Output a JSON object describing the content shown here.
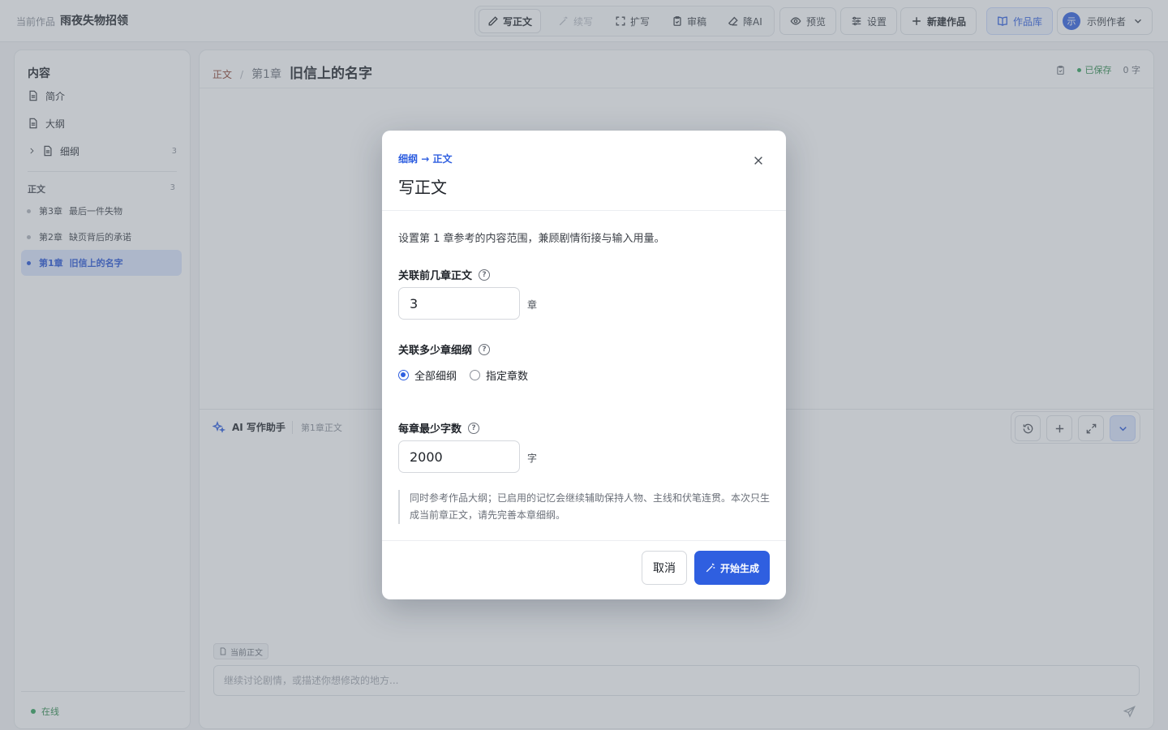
{
  "header": {
    "project_label": "当前作品",
    "project_name": "雨夜失物招领",
    "tools": [
      {
        "label": "写正文",
        "icon": "pencil-icon",
        "state": "active"
      },
      {
        "label": "续写",
        "icon": "magic-wand-icon",
        "state": "disabled"
      },
      {
        "label": "扩写",
        "icon": "expand-icon",
        "state": "normal"
      },
      {
        "label": "审稿",
        "icon": "clipboard-check-icon",
        "state": "normal"
      },
      {
        "label": "降AI",
        "icon": "eraser-icon",
        "state": "normal"
      }
    ],
    "preview_label": "预览",
    "settings_label": "设置",
    "new_work_label": "新建作品",
    "library_label": "作品库",
    "user_avatar": "示",
    "user_name": "示例作者"
  },
  "sidebar": {
    "heading": "内容",
    "items": [
      {
        "label": "简介",
        "icon": "document-icon"
      },
      {
        "label": "大纲",
        "icon": "document-icon"
      },
      {
        "label": "细纲",
        "icon": "document-icon",
        "count": "3"
      }
    ],
    "body_heading": "正文",
    "body_count": "3",
    "chapters": [
      {
        "num": "第3章",
        "title": "最后一件失物",
        "active": false
      },
      {
        "num": "第2章",
        "title": "缺页背后的承诺",
        "active": false
      },
      {
        "num": "第1章",
        "title": "旧信上的名字",
        "active": true
      }
    ],
    "status": "在线"
  },
  "editor": {
    "breadcrumb_section": "正文",
    "breadcrumb_sep": "/",
    "chapter_num": "第1章",
    "chapter_title": "旧信上的名字",
    "saved_label": "已保存",
    "word_count": "0 字"
  },
  "ai_panel": {
    "title": "AI 写作助手",
    "context": "第1章正文",
    "chip_label": "当前正文",
    "input_placeholder": "继续讨论剧情，或描述你想修改的地方..."
  },
  "modal": {
    "flow_from": "细纲",
    "flow_arrow": "→",
    "flow_to": "正文",
    "title": "写正文",
    "description": "设置第 1 章参考的内容范围，兼顾剧情衔接与输入用量。",
    "prev_chapters_label": "关联前几章正文",
    "prev_chapters_value": "3",
    "prev_chapters_unit": "章",
    "outline_label": "关联多少章细纲",
    "outline_options": [
      "全部细纲",
      "指定章数"
    ],
    "outline_selected": "全部细纲",
    "min_words_label": "每章最少字数",
    "min_words_value": "2000",
    "min_words_unit": "字",
    "note": "同时参考作品大纲；已启用的记忆会继续辅助保持人物、主线和伏笔连贯。本次只生成当前章正文，请先完善本章细纲。",
    "help_glyph": "?",
    "cancel_label": "取消",
    "start_label": "开始生成"
  },
  "colors": {
    "accent": "#2f5fe0",
    "success": "#2fa25a",
    "overlay": "rgba(110,118,130,0.42)"
  }
}
